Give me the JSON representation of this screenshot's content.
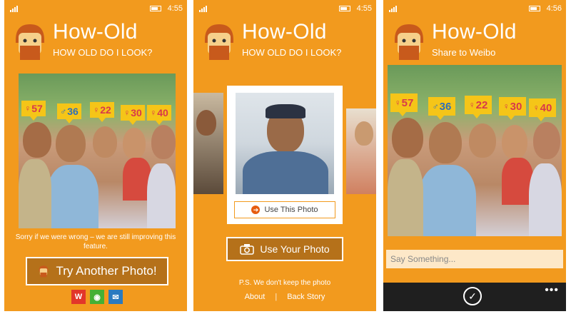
{
  "status": {
    "time_1": "4:55",
    "time_2": "4:55",
    "time_3": "4:56"
  },
  "app": {
    "title": "How-Old",
    "subtitle": "HOW OLD DO I LOOK?",
    "share_subtitle": "Share to Weibo"
  },
  "tags": [
    {
      "gender": "♀",
      "age": "57"
    },
    {
      "gender": "♂",
      "age": "36"
    },
    {
      "gender": "♀",
      "age": "22"
    },
    {
      "gender": "♀",
      "age": "30"
    },
    {
      "gender": "♀",
      "age": "40"
    }
  ],
  "screen1": {
    "sorry_text": "Sorry if we were wrong – we are still improving this feature.",
    "try_button": "Try Another Photo!",
    "social": {
      "weibo_icon": "weibo-icon",
      "wechat_icon": "wechat-icon",
      "mail_icon": "mail-icon"
    }
  },
  "screen2": {
    "use_this_button": "Use This Photo",
    "use_your_button": "Use Your Photo",
    "ps_text": "P.S. We don't keep the photo",
    "about_link": "About",
    "back_story_link": "Back Story"
  },
  "screen3": {
    "say_placeholder": "Say Something...",
    "confirm_icon": "check-icon",
    "more_icon": "more-icon"
  },
  "colors": {
    "accent": "#f29a1e",
    "button": "#b5711a",
    "tag": "#f5c518",
    "appbar": "#1f1f1f"
  }
}
